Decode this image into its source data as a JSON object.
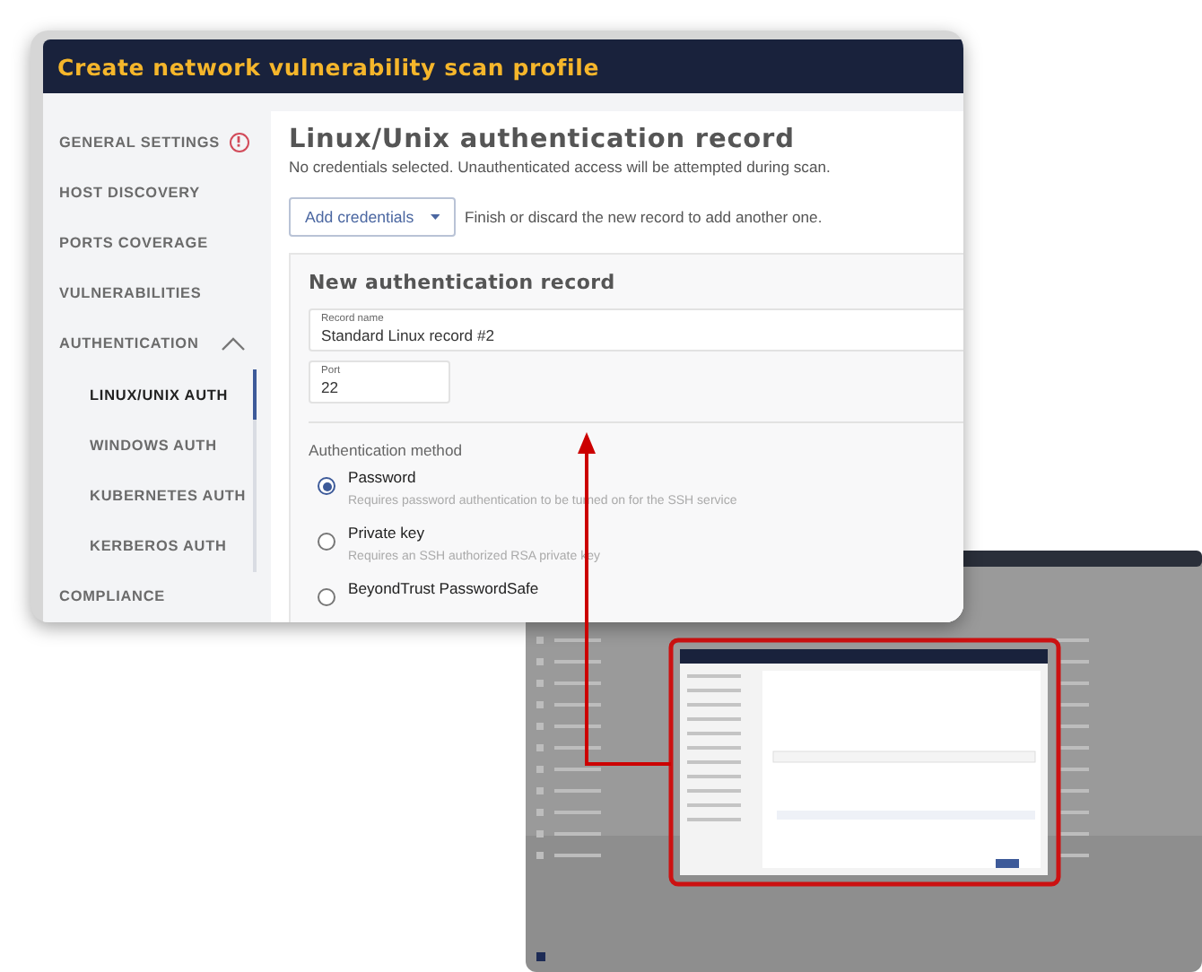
{
  "dialog": {
    "title": "Create network vulnerability scan profile",
    "sidebar": {
      "items": [
        {
          "label": "GENERAL SETTINGS",
          "warning": true,
          "selected": false
        },
        {
          "label": "HOST DISCOVERY",
          "warning": false,
          "selected": false
        },
        {
          "label": "PORTS COVERAGE",
          "warning": false,
          "selected": false
        },
        {
          "label": "VULNERABILITIES",
          "warning": false,
          "selected": false
        },
        {
          "label": "AUTHENTICATION",
          "warning": false,
          "selected": false,
          "expanded": true,
          "children": [
            {
              "label": "LINUX/UNIX AUTH",
              "selected": true
            },
            {
              "label": "WINDOWS AUTH",
              "selected": false
            },
            {
              "label": "KUBERNETES AUTH",
              "selected": false
            },
            {
              "label": "KERBEROS AUTH",
              "selected": false
            }
          ]
        },
        {
          "label": "COMPLIANCE",
          "warning": false,
          "selected": false
        }
      ]
    },
    "content": {
      "heading": "Linux/Unix authentication record",
      "subtitle": "No credentials selected. Unauthenticated access will be attempted during scan.",
      "add_button": "Add credentials",
      "add_hint": "Finish or discard the new record to add another one.",
      "record": {
        "heading": "New authentication record",
        "fields": [
          {
            "label": "Record name",
            "value": "Standard Linux record #2"
          },
          {
            "label": "Port",
            "value": "22"
          }
        ],
        "method_label": "Authentication method",
        "methods": [
          {
            "label": "Password",
            "description": "Requires password authentication to be turned on for the SSH service",
            "selected": true
          },
          {
            "label": "Private key",
            "description": "Requires an SSH authorized RSA private key",
            "selected": false
          },
          {
            "label": "BeyondTrust PasswordSafe",
            "selected": false
          }
        ]
      }
    }
  }
}
